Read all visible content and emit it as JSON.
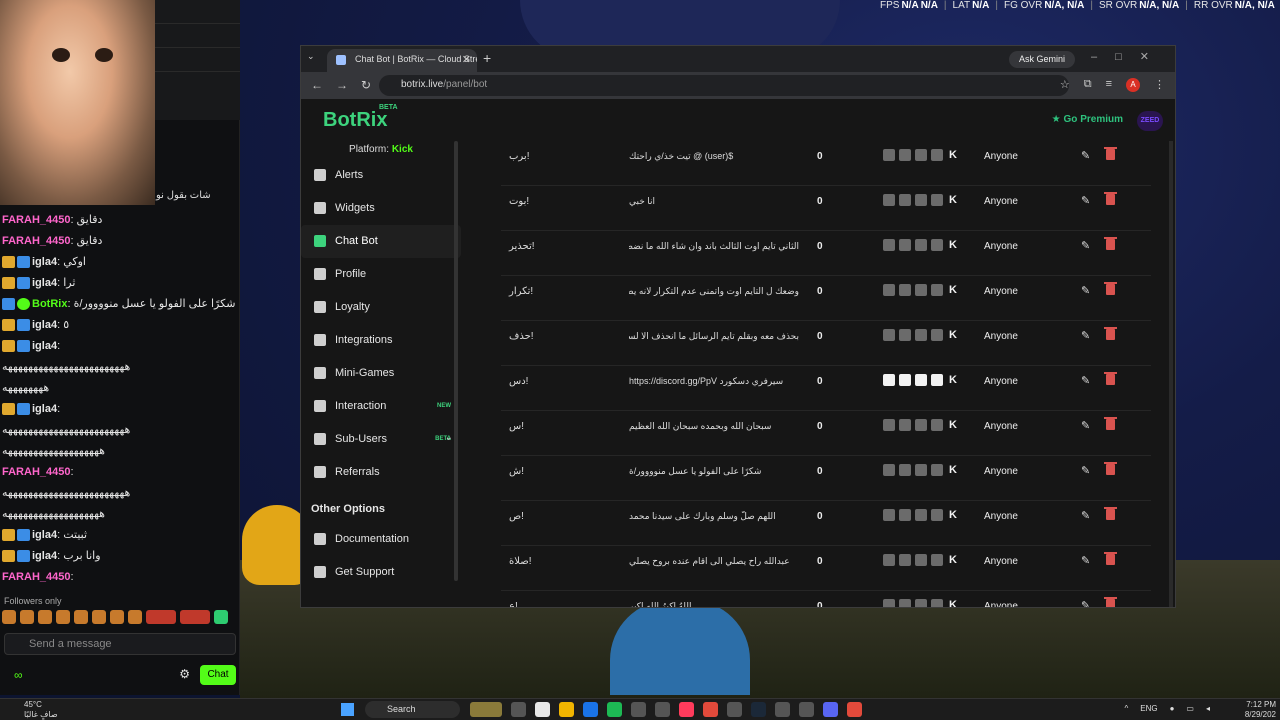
{
  "hud": {
    "fps_label": "FPS",
    "fps_value": "N/A",
    "fps2_value": "N/A",
    "lat_label": "LAT",
    "lat_value": "N/A",
    "fgovr_label": "FG OVR",
    "fgovr_value": "N/A, N/A",
    "srovr_label": "SR OVR",
    "srovr_value": "N/A, N/A",
    "rrovr_label": "RR OVR",
    "rrovr_value": "N/A, N/A"
  },
  "stream_chat": {
    "messages": [
      {
        "badges": [],
        "name": "FARAH_4450",
        "name_color": "#ff66cc",
        "text": ": دقايق"
      },
      {
        "badges": [],
        "name": "FARAH_4450",
        "name_color": "#ff66cc",
        "text": ": دقايق"
      },
      {
        "badges": [
          "crown",
          "mod"
        ],
        "name": "igla4",
        "name_color": "#e6e6e6",
        "text": ": اوكي"
      },
      {
        "badges": [
          "crown",
          "mod"
        ],
        "name": "igla4",
        "name_color": "#e6e6e6",
        "text": ": ثرا"
      },
      {
        "badges": [
          "mod",
          "ok"
        ],
        "name": "BotRix",
        "name_color": "#53fc18",
        "text": ": شكرًا على الفولو يا عسل منوووور/ة"
      },
      {
        "badges": [
          "crown",
          "mod"
        ],
        "name": "igla4",
        "name_color": "#e6e6e6",
        "text": ": ٥"
      },
      {
        "badges": [
          "crown",
          "mod"
        ],
        "name": "igla4",
        "name_color": "#e6e6e6",
        "text": ":"
      },
      {
        "badges": [],
        "name": "",
        "name_color": "#e6e6e6",
        "text": "ههههههههههههههههههههههههه"
      },
      {
        "badges": [],
        "name": "",
        "name_color": "#e6e6e6",
        "text": "ههههههههه"
      },
      {
        "badges": [
          "crown",
          "mod"
        ],
        "name": "igla4",
        "name_color": "#e6e6e6",
        "text": ":"
      },
      {
        "badges": [],
        "name": "",
        "name_color": "#e6e6e6",
        "text": "ههههههههههههههههههههههههه"
      },
      {
        "badges": [],
        "name": "",
        "name_color": "#e6e6e6",
        "text": "هههههههههههههههههههه"
      },
      {
        "badges": [],
        "name": "FARAH_4450",
        "name_color": "#ff66cc",
        "text": ":"
      },
      {
        "badges": [],
        "name": "",
        "name_color": "#e6e6e6",
        "text": "ههههههههههههههههههههههههه"
      },
      {
        "badges": [],
        "name": "",
        "name_color": "#e6e6e6",
        "text": "هههههههههههههههههههه"
      },
      {
        "badges": [
          "crown",
          "mod"
        ],
        "name": "igla4",
        "name_color": "#e6e6e6",
        "text": ": ثبيتت"
      },
      {
        "badges": [
          "crown",
          "mod"
        ],
        "name": "igla4",
        "name_color": "#e6e6e6",
        "text": ": وانا برب"
      },
      {
        "badges": [],
        "name": "FARAH_4450",
        "name_color": "#ff66cc",
        "text": ":"
      }
    ],
    "top_message": "شات بقول نو",
    "followers_only": "Followers only",
    "send_placeholder": "Send a message",
    "infinity": "∞",
    "chat_button": "Chat"
  },
  "browser": {
    "tab_title": "Chat Bot | BotRix — Cloud Stre",
    "ask_gemini": "Ask Gemini",
    "url_host": "botrix.live",
    "url_path": "/panel/bot",
    "profile_initial": "A"
  },
  "app": {
    "logo": "BotRix",
    "beta": "BETA",
    "go_premium": "Go Premium",
    "avatar_text": "ZEED",
    "platform_label": "Platform:",
    "platform_value": "Kick",
    "nav": [
      {
        "label": "Alerts",
        "active": false,
        "tag": ""
      },
      {
        "label": "Widgets",
        "active": false,
        "tag": ""
      },
      {
        "label": "Chat Bot",
        "active": true,
        "tag": ""
      },
      {
        "label": "Profile",
        "active": false,
        "tag": ""
      },
      {
        "label": "Loyalty",
        "active": false,
        "tag": ""
      },
      {
        "label": "Integrations",
        "active": false,
        "tag": ""
      },
      {
        "label": "Mini-Games",
        "active": false,
        "tag": ""
      },
      {
        "label": "Interaction",
        "active": false,
        "tag": "NEW"
      },
      {
        "label": "Sub-Users",
        "active": false,
        "tag": "BETA"
      },
      {
        "label": "Referrals",
        "active": false,
        "tag": ""
      }
    ],
    "other_options": "Other Options",
    "other_nav": [
      {
        "label": "Documentation"
      },
      {
        "label": "Get Support"
      }
    ]
  },
  "commands": [
    {
      "name": "!برب",
      "response": "$(user) @ تيت خذ/ي راحتك",
      "count": "0",
      "permission": "Anyone"
    },
    {
      "name": "!بوت",
      "response": "انا خبي",
      "count": "0",
      "permission": "Anyone"
    },
    {
      "name": "!تحذير",
      "response": "الثاني تايم اوت الثالث باند وان شاء الله ما نضطر للباند",
      "count": "0",
      "permission": "Anyone"
    },
    {
      "name": "!تكرار",
      "response": "وضعك ل التايم اوت واتمنى عدم التكرار لانه يضر القناة",
      "count": "0",
      "permission": "Anyone"
    },
    {
      "name": "!حذف",
      "response": "بحذف معه وبقلم تايم الرسائل ما انحذف الا لسبب وجيه",
      "count": "0",
      "permission": "Anyone"
    },
    {
      "name": "!دس",
      "response": "سيرفري دسكورد https://discord.gg/PpV",
      "count": "0",
      "permission": "Anyone"
    },
    {
      "name": "!س",
      "response": "سبحان الله وبحمده سبحان الله العظيم",
      "count": "0",
      "permission": "Anyone"
    },
    {
      "name": "!ش",
      "response": "شكرًا على الفولو يا عسل منوووور/ة",
      "count": "0",
      "permission": "Anyone"
    },
    {
      "name": "!ص",
      "response": "اللهم صلّ وسلم وبارك على سيدنا محمد",
      "count": "0",
      "permission": "Anyone"
    },
    {
      "name": "!صلاة",
      "response": "عبدالله راح يصلي الى اقام عنده بروح يصلي",
      "count": "0",
      "permission": "Anyone"
    },
    {
      "name": "!ع",
      "response": "اللهُ اكبرُ الله اكبر",
      "count": "0",
      "permission": "Anyone"
    }
  ],
  "taskbar": {
    "temp": "45°C",
    "weather_text": "صافٍ غالبًا",
    "search": "Search",
    "lang": "ENG",
    "time": "7:12 PM",
    "date": "8/29/202"
  }
}
